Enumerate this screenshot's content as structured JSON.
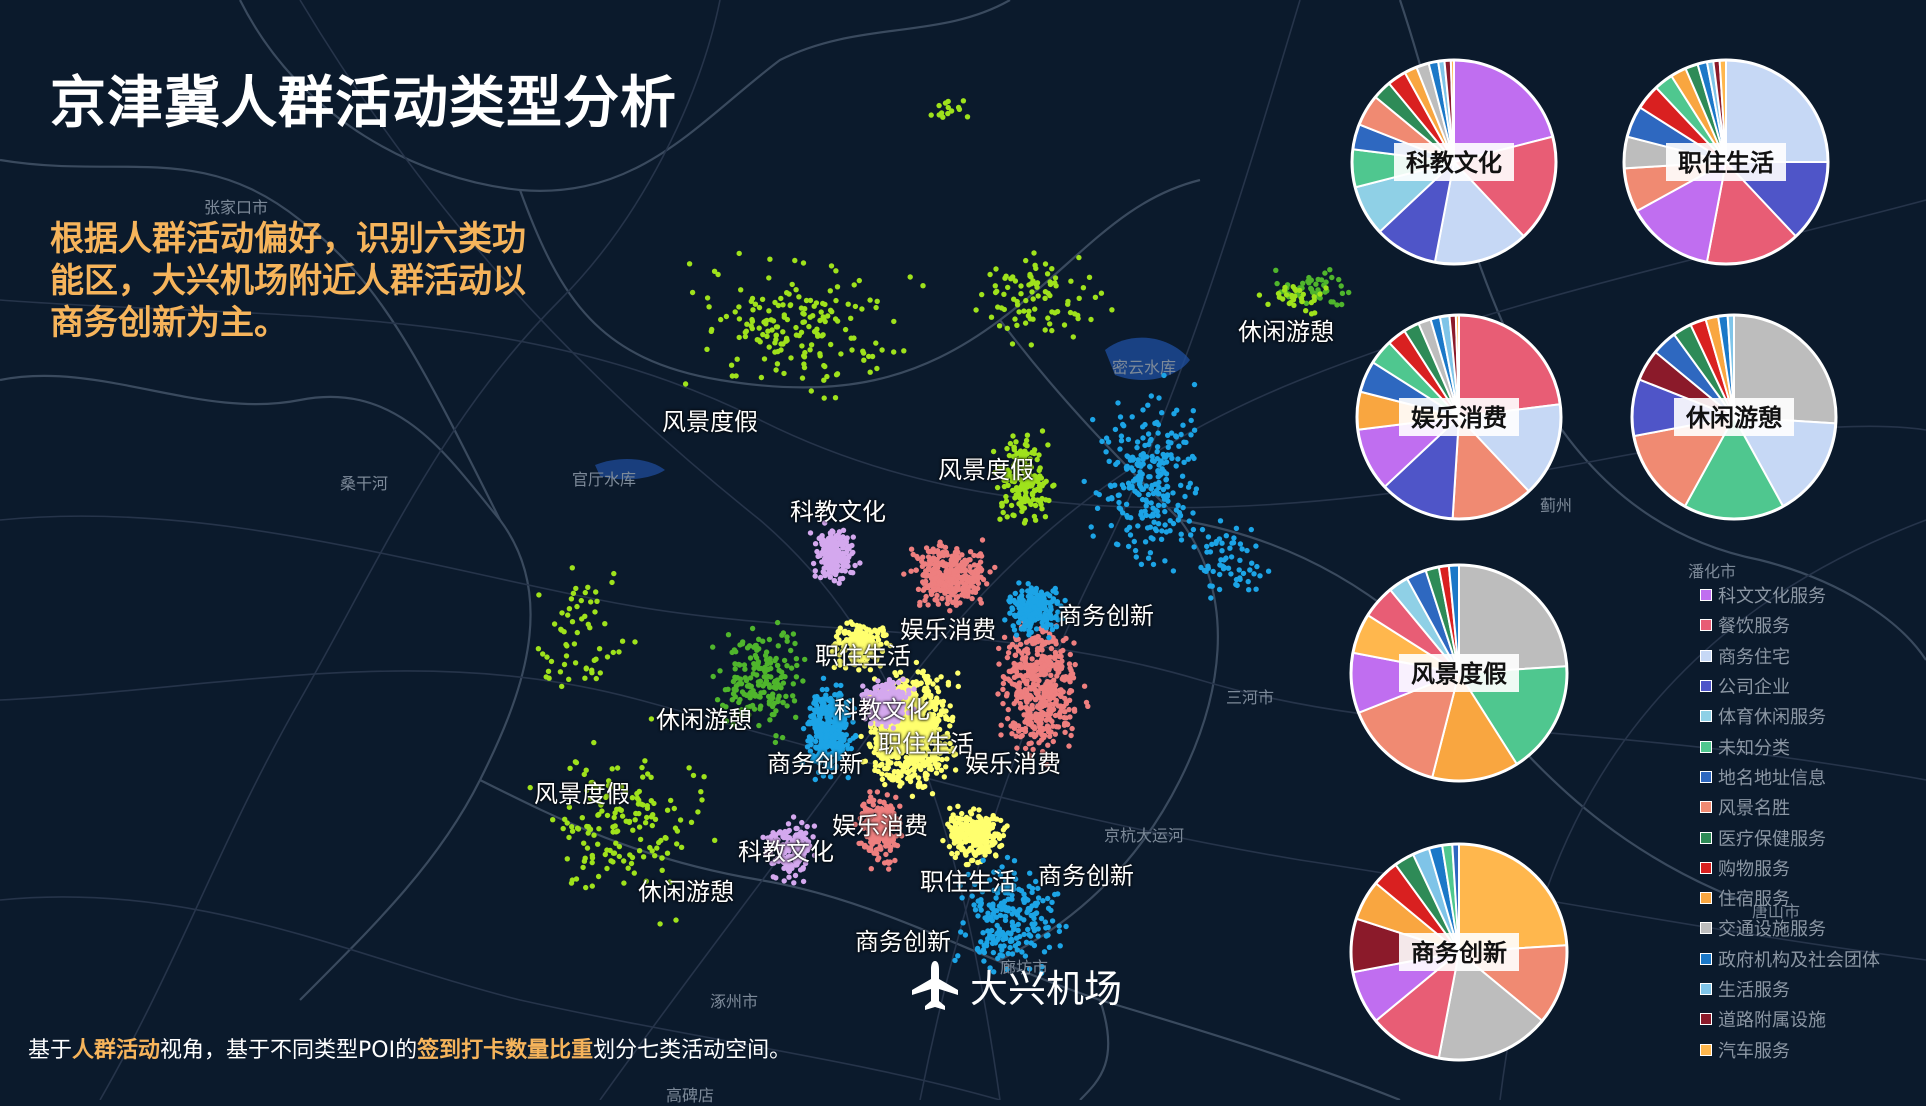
{
  "page": {
    "title": "京津冀人群活动类型分析",
    "subtitle": "根据人群活动偏好，识别六类功能区，大兴机场附近人群活动以商务创新为主。",
    "footer": {
      "p1": "基于",
      "h1": "人群活动",
      "p2": "视角，基于不同类型POI的",
      "h2": "签到打卡数量比重",
      "p3": "划分七类活动空间。"
    },
    "airport_label": "大兴机场",
    "icon": "airplane-icon"
  },
  "colors": {
    "background": "#0b1a2c",
    "accent": "#f6b45b",
    "zones": {
      "科教文化": "#d4a8ee",
      "职住生活": "#ffff6e",
      "娱乐消费": "#ee7f7f",
      "商务创新": "#1ca4e6",
      "风景度假": "#9fe21c",
      "休闲游憩": "#4fb52c"
    }
  },
  "map": {
    "zone_labels": [
      {
        "text": "风景度假"
      },
      {
        "text": "风景度假"
      },
      {
        "text": "科教文化"
      },
      {
        "text": "休闲游憩"
      },
      {
        "text": "娱乐消费"
      },
      {
        "text": "商务创新"
      },
      {
        "text": "职住生活"
      },
      {
        "text": "科教文化"
      },
      {
        "text": "休闲游憩"
      },
      {
        "text": "职住生活"
      },
      {
        "text": "商务创新"
      },
      {
        "text": "娱乐消费"
      },
      {
        "text": "风景度假"
      },
      {
        "text": "娱乐消费"
      },
      {
        "text": "科教文化"
      },
      {
        "text": "职住生活"
      },
      {
        "text": "商务创新"
      },
      {
        "text": "休闲游憩"
      },
      {
        "text": "商务创新"
      }
    ],
    "basemap_labels": [
      {
        "text": "张家口市"
      },
      {
        "text": "桑干河"
      },
      {
        "text": "官厅水库"
      },
      {
        "text": "密云水库"
      },
      {
        "text": "三河市"
      },
      {
        "text": "廊坊市"
      },
      {
        "text": "涿州市"
      },
      {
        "text": "高碑店"
      },
      {
        "text": "京杭大运河"
      },
      {
        "text": "蓟州"
      },
      {
        "text": "唐山市"
      },
      {
        "text": "潘化市"
      }
    ]
  },
  "pies": [
    {
      "label": "科教文化",
      "slices": [
        {
          "category": "科文文化服务",
          "value": 21.0
        },
        {
          "category": "餐饮服务",
          "value": 17.0
        },
        {
          "category": "商务住宅",
          "value": 15.0
        },
        {
          "category": "公司企业",
          "value": 10.0
        },
        {
          "category": "体育休闲服务",
          "value": 8.0
        },
        {
          "category": "未知分类",
          "value": 6.0
        },
        {
          "category": "地名地址信息",
          "value": 4.0
        },
        {
          "category": "风景名胜",
          "value": 5.0
        },
        {
          "category": "医疗保健服务",
          "value": 3.0
        },
        {
          "category": "购物服务",
          "value": 3.0
        },
        {
          "category": "住宿服务",
          "value": 2.0
        },
        {
          "category": "交通设施服务",
          "value": 2.0
        },
        {
          "category": "政府机构及社会团体",
          "value": 1.5
        },
        {
          "category": "生活服务",
          "value": 1.0
        },
        {
          "category": "道路附属设施",
          "value": 1.0
        },
        {
          "category": "汽车服务",
          "value": 0.5
        }
      ]
    },
    {
      "label": "职住生活",
      "slices": [
        {
          "category": "商务住宅",
          "value": 25.0
        },
        {
          "category": "公司企业",
          "value": 13.0
        },
        {
          "category": "餐饮服务",
          "value": 15.0
        },
        {
          "category": "科文文化服务",
          "value": 14.0
        },
        {
          "category": "风景名胜",
          "value": 7.0
        },
        {
          "category": "交通设施服务",
          "value": 5.0
        },
        {
          "category": "地名地址信息",
          "value": 5.0
        },
        {
          "category": "购物服务",
          "value": 4.0
        },
        {
          "category": "未知分类",
          "value": 3.0
        },
        {
          "category": "住宿服务",
          "value": 2.5
        },
        {
          "category": "医疗保健服务",
          "value": 2.0
        },
        {
          "category": "政府机构及社会团体",
          "value": 1.5
        },
        {
          "category": "生活服务",
          "value": 1.0
        },
        {
          "category": "道路附属设施",
          "value": 1.0
        },
        {
          "category": "汽车服务",
          "value": 1.0
        }
      ]
    },
    {
      "label": "娱乐消费",
      "slices": [
        {
          "category": "餐饮服务",
          "value": 23.0
        },
        {
          "category": "商务住宅",
          "value": 15.0
        },
        {
          "category": "风景名胜",
          "value": 13.0
        },
        {
          "category": "公司企业",
          "value": 12.0
        },
        {
          "category": "科文文化服务",
          "value": 10.0
        },
        {
          "category": "住宿服务",
          "value": 6.0
        },
        {
          "category": "地名地址信息",
          "value": 5.0
        },
        {
          "category": "未知分类",
          "value": 4.0
        },
        {
          "category": "购物服务",
          "value": 3.0
        },
        {
          "category": "医疗保健服务",
          "value": 2.5
        },
        {
          "category": "交通设施服务",
          "value": 2.0
        },
        {
          "category": "政府机构及社会团体",
          "value": 1.5
        },
        {
          "category": "生活服务",
          "value": 1.5
        },
        {
          "category": "道路附属设施",
          "value": 1.0
        },
        {
          "category": "汽车服务",
          "value": 0.5
        }
      ]
    },
    {
      "label": "休闲游憩",
      "slices": [
        {
          "category": "交通设施服务",
          "value": 26.0
        },
        {
          "category": "商务住宅",
          "value": 16.0
        },
        {
          "category": "未知分类",
          "value": 16.0
        },
        {
          "category": "风景名胜",
          "value": 14.0
        },
        {
          "category": "公司企业",
          "value": 9.0
        },
        {
          "category": "道路附属设施",
          "value": 5.0
        },
        {
          "category": "地名地址信息",
          "value": 4.0
        },
        {
          "category": "医疗保健服务",
          "value": 3.0
        },
        {
          "category": "购物服务",
          "value": 2.5
        },
        {
          "category": "住宿服务",
          "value": 2.0
        },
        {
          "category": "政府机构及社会团体",
          "value": 1.5
        },
        {
          "category": "生活服务",
          "value": 1.0
        }
      ]
    },
    {
      "label": "风景度假",
      "slices": [
        {
          "category": "交通设施服务",
          "value": 24.0
        },
        {
          "category": "未知分类",
          "value": 17.0
        },
        {
          "category": "住宿服务",
          "value": 13.0
        },
        {
          "category": "风景名胜",
          "value": 15.0
        },
        {
          "category": "科文文化服务",
          "value": 9.0
        },
        {
          "category": "汽车服务",
          "value": 6.0
        },
        {
          "category": "餐饮服务",
          "value": 5.0
        },
        {
          "category": "体育休闲服务",
          "value": 3.0
        },
        {
          "category": "地名地址信息",
          "value": 3.0
        },
        {
          "category": "医疗保健服务",
          "value": 2.0
        },
        {
          "category": "购物服务",
          "value": 1.5
        },
        {
          "category": "政府机构及社会团体",
          "value": 1.5
        }
      ]
    },
    {
      "label": "商务创新",
      "slices": [
        {
          "category": "汽车服务",
          "value": 24.0
        },
        {
          "category": "风景名胜",
          "value": 12.0
        },
        {
          "category": "交通设施服务",
          "value": 17.0
        },
        {
          "category": "餐饮服务",
          "value": 11.0
        },
        {
          "category": "科文文化服务",
          "value": 8.0
        },
        {
          "category": "道路附属设施",
          "value": 8.0
        },
        {
          "category": "住宿服务",
          "value": 6.0
        },
        {
          "category": "购物服务",
          "value": 4.0
        },
        {
          "category": "医疗保健服务",
          "value": 3.0
        },
        {
          "category": "生活服务",
          "value": 2.5
        },
        {
          "category": "政府机构及社会团体",
          "value": 2.0
        },
        {
          "category": "未知分类",
          "value": 1.5
        },
        {
          "category": "地名地址信息",
          "value": 1.0
        }
      ]
    }
  ],
  "legend": [
    {
      "label": "科文文化服务",
      "color": "#c06ef0"
    },
    {
      "label": "餐饮服务",
      "color": "#e85d75"
    },
    {
      "label": "商务住宅",
      "color": "#c6d8f5"
    },
    {
      "label": "公司企业",
      "color": "#4f55c8"
    },
    {
      "label": "体育休闲服务",
      "color": "#8fd0e6"
    },
    {
      "label": "未知分类",
      "color": "#4fc78f"
    },
    {
      "label": "地名地址信息",
      "color": "#2e68c0"
    },
    {
      "label": "风景名胜",
      "color": "#f08a72"
    },
    {
      "label": "医疗保健服务",
      "color": "#2e8b57"
    },
    {
      "label": "购物服务",
      "color": "#d92020"
    },
    {
      "label": "住宿服务",
      "color": "#f9a640"
    },
    {
      "label": "交通设施服务",
      "color": "#bdbdbd"
    },
    {
      "label": "政府机构及社会团体",
      "color": "#1b78c8"
    },
    {
      "label": "生活服务",
      "color": "#7fc4e8"
    },
    {
      "label": "道路附属设施",
      "color": "#8b1a2a"
    },
    {
      "label": "汽车服务",
      "color": "#ffb74d"
    }
  ]
}
